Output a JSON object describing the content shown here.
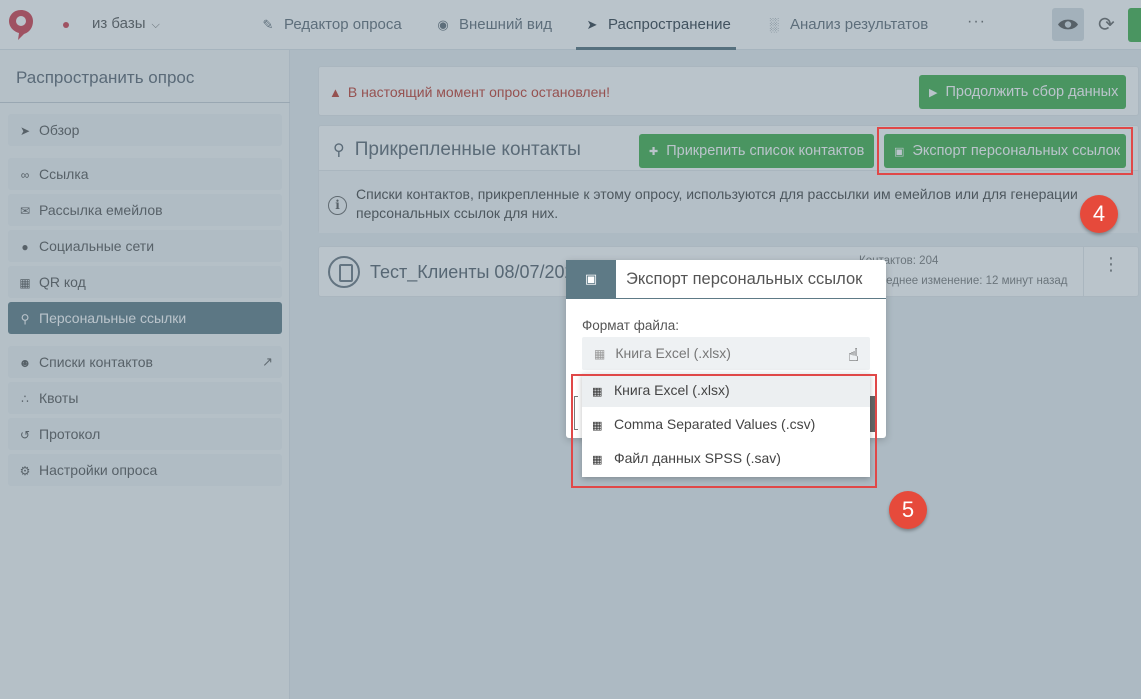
{
  "topbar": {
    "survey_name": "из базы",
    "tabs": [
      {
        "label": "Редактор опроса",
        "icon": "edit-icon"
      },
      {
        "label": "Внешний вид",
        "icon": "palette-icon"
      },
      {
        "label": "Распространение",
        "icon": "send-icon",
        "active": true
      },
      {
        "label": "Анализ результатов",
        "icon": "bar-chart-icon"
      }
    ],
    "more": "···"
  },
  "sidebar": {
    "title": "Распространить опрос",
    "items": [
      {
        "label": "Обзор",
        "icon": "send-icon"
      },
      {
        "label": "Ссылка",
        "icon": "link-icon"
      },
      {
        "label": "Рассылка емейлов",
        "icon": "mail-icon"
      },
      {
        "label": "Социальные сети",
        "icon": "facebook-icon"
      },
      {
        "label": "QR код",
        "icon": "qr-icon"
      },
      {
        "label": "Персональные ссылки",
        "icon": "personal-link-icon",
        "active": true
      },
      {
        "label": "Списки контактов",
        "icon": "contacts-icon"
      },
      {
        "label": "Квоты",
        "icon": "quota-icon"
      },
      {
        "label": "Протокол",
        "icon": "history-icon"
      },
      {
        "label": "Настройки опроса",
        "icon": "gear-icon"
      }
    ]
  },
  "main": {
    "alert_text": "В настоящий момент опрос остановлен!",
    "continue_button": "Продолжить сбор данных",
    "contacts_title": "Прикрепленные контакты",
    "attach_button": "Прикрепить список контактов",
    "export_button": "Экспорт персональных ссылок",
    "info_text": "Списки контактов, прикрепленные к этому опросу, используются для рассылки им емейлов или для генерации персональных ссылок для них.",
    "list": {
      "name": "Тест_Клиенты 08/07/202",
      "count": "Контактов: 204",
      "modified": "Последнее изменение: 12 минут назад"
    }
  },
  "modal": {
    "title": "Экспорт персональных ссылок",
    "format_label": "Формат файла:",
    "selected": "Книга Excel (.xlsx)",
    "options": [
      "Книга Excel (.xlsx)",
      "Comma Separated Values (.csv)",
      "Файл данных SPSS (.sav)"
    ]
  },
  "callouts": {
    "step4": "4",
    "step5": "5"
  },
  "colors": {
    "accent": "#5e7a86",
    "green": "#3fae49",
    "alert": "#c0392b",
    "callout": "#e64a3b"
  }
}
